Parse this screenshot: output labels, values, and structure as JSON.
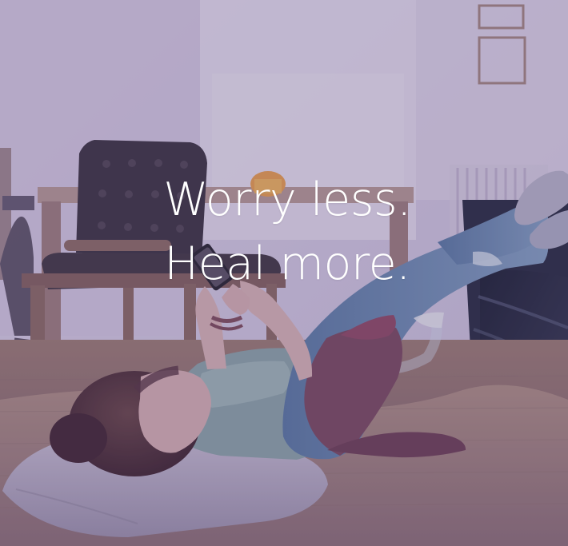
{
  "hero": {
    "headline_line_1": "Worry less.",
    "headline_line_2": "Heal more.",
    "accent_text_color": "#ffffff",
    "overlay_color": "#462d6e"
  }
}
